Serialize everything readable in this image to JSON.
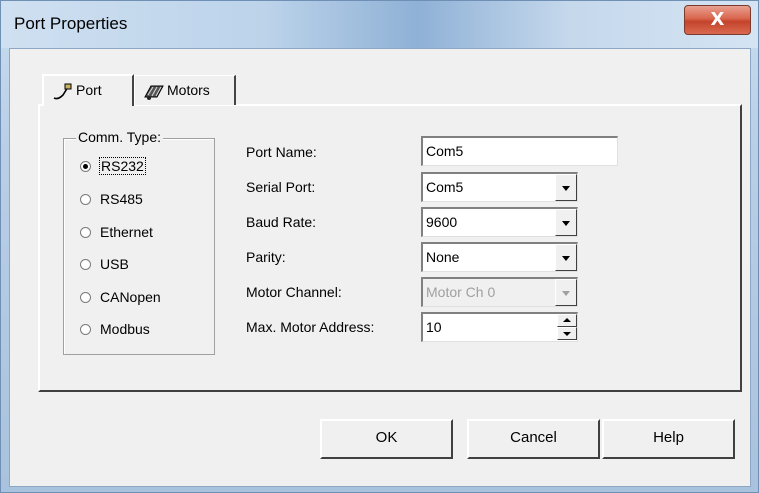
{
  "window": {
    "title": "Port Properties",
    "close_label": "X"
  },
  "tabs": [
    {
      "label": "Port",
      "icon": "port-icon",
      "active": true
    },
    {
      "label": "Motors",
      "icon": "motors-icon",
      "active": false
    }
  ],
  "comm_type": {
    "legend": "Comm. Type:",
    "options": [
      "RS232",
      "RS485",
      "Ethernet",
      "USB",
      "CANopen",
      "Modbus"
    ],
    "selected": "RS232"
  },
  "fields": {
    "port_name": {
      "label": "Port Name:",
      "value": "Com5"
    },
    "serial_port": {
      "label": "Serial Port:",
      "value": "Com5"
    },
    "baud_rate": {
      "label": "Baud Rate:",
      "value": "9600"
    },
    "parity": {
      "label": "Parity:",
      "value": "None"
    },
    "motor_channel": {
      "label": "Motor Channel:",
      "value": "Motor Ch 0",
      "disabled": true
    },
    "max_motor_address": {
      "label": "Max. Motor Address:",
      "value": "10"
    }
  },
  "buttons": {
    "ok": "OK",
    "cancel": "Cancel",
    "help": "Help"
  }
}
